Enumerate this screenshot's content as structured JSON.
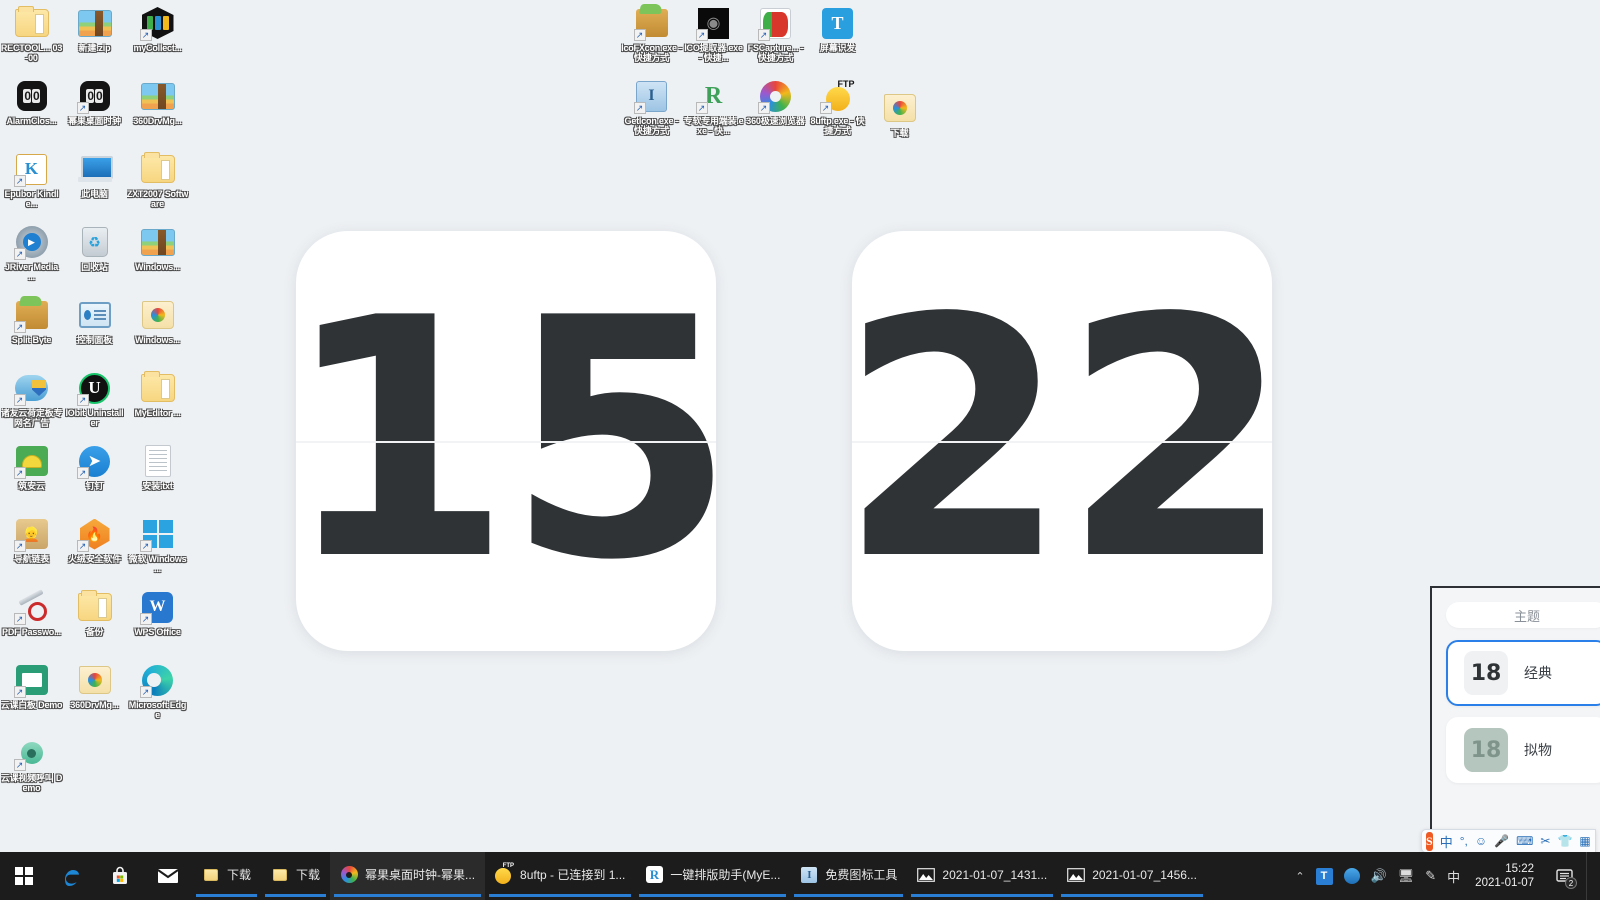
{
  "desktop": {
    "background_color": "#eef1f4",
    "icons_left": [
      {
        "label": "RECTOOL... 03-00",
        "icon": "folder-icon",
        "shortcut": false,
        "art": "folder"
      },
      {
        "label": "新建.zip",
        "icon": "zip-archive-icon",
        "shortcut": false,
        "art": "zip"
      },
      {
        "label": "myCollect...",
        "icon": "mycollect-icon",
        "shortcut": true,
        "art": "hexbook"
      },
      {
        "label": "AlarmClos...",
        "icon": "alarm-clock-icon",
        "shortcut": false,
        "art": "blackbox"
      },
      {
        "label": "幂果桌面时钟",
        "icon": "flip-clock-icon",
        "shortcut": true,
        "art": "blackbox"
      },
      {
        "label": "360DrvMg...",
        "icon": "zip-archive-icon",
        "shortcut": false,
        "art": "zip"
      },
      {
        "label": "Epubor Kindle...",
        "icon": "epubor-icon",
        "shortcut": true,
        "art": "epubor"
      },
      {
        "label": "此电脑",
        "icon": "this-pc-icon",
        "shortcut": false,
        "art": "monitor"
      },
      {
        "label": "ZXT2007 Software",
        "icon": "folder-icon",
        "shortcut": false,
        "art": "folder"
      },
      {
        "label": "JRiver Media ...",
        "icon": "jriver-icon",
        "shortcut": true,
        "art": "disc"
      },
      {
        "label": "回收站",
        "icon": "recycle-bin-icon",
        "shortcut": false,
        "art": "trash"
      },
      {
        "label": "Windows...",
        "icon": "zip-archive-icon",
        "shortcut": false,
        "art": "zip"
      },
      {
        "label": "Split Byte",
        "icon": "split-byte-icon",
        "shortcut": true,
        "art": "box3d"
      },
      {
        "label": "控制面板",
        "icon": "control-panel-icon",
        "shortcut": false,
        "art": "cpanel"
      },
      {
        "label": "Windows...",
        "icon": "folder-icon",
        "shortcut": false,
        "art": "folderimg"
      },
      {
        "label": "诸友云荷定板专网名广告",
        "icon": "cloud-shield-icon",
        "shortcut": true,
        "art": "cloud"
      },
      {
        "label": "IObit Uninstaller",
        "icon": "iobit-uninstaller-icon",
        "shortcut": true,
        "art": "circleU"
      },
      {
        "label": "MyEditor ...",
        "icon": "folder-icon",
        "shortcut": false,
        "art": "folder"
      },
      {
        "label": "筑安云",
        "icon": "helmet-icon",
        "shortcut": true,
        "art": "helmet"
      },
      {
        "label": "钉钉",
        "icon": "dingtalk-icon",
        "shortcut": true,
        "art": "ding"
      },
      {
        "label": "安装.txt",
        "icon": "text-file-icon",
        "shortcut": false,
        "art": "txt"
      },
      {
        "label": "导航链表",
        "icon": "avatar-shield-icon",
        "shortcut": true,
        "art": "avatar"
      },
      {
        "label": "火绒安全软件",
        "icon": "huorong-icon",
        "shortcut": true,
        "art": "flame"
      },
      {
        "label": "微软 Windows ...",
        "icon": "windows-logo-icon",
        "shortcut": true,
        "art": "win"
      },
      {
        "label": "PDF Passwo...",
        "icon": "pdf-password-icon",
        "shortcut": true,
        "art": "pdf"
      },
      {
        "label": "备份",
        "icon": "folder-icon",
        "shortcut": false,
        "art": "folder"
      },
      {
        "label": "WPS Office",
        "icon": "wps-office-icon",
        "shortcut": true,
        "art": "wps"
      },
      {
        "label": "云课白板 Demo",
        "icon": "whiteboard-demo-icon",
        "shortcut": true,
        "art": "board"
      },
      {
        "label": "360DrvMg...",
        "icon": "folder-icon",
        "shortcut": false,
        "art": "folderimg"
      },
      {
        "label": "Microsoft Edge",
        "icon": "edge-icon",
        "shortcut": true,
        "art": "edge"
      },
      {
        "label": "云课视频呼叫 Demo",
        "icon": "video-call-demo-icon",
        "shortcut": true,
        "art": "cam"
      }
    ],
    "icons_mid": [
      {
        "label": "IcoFXcon.exe - 快捷方式",
        "icon": "icofx-icon",
        "shortcut": true,
        "art": "box3d"
      },
      {
        "label": "ICO提取器.exe - 快捷...",
        "icon": "ico-extractor-icon",
        "shortcut": true,
        "art": "darkgrid"
      },
      {
        "label": "FSCapture... - 快捷方式",
        "icon": "fscapture-icon",
        "shortcut": true,
        "art": "fsc"
      },
      {
        "label": "屏幕识发",
        "icon": "screen-text-icon",
        "shortcut": false,
        "art": "bluet"
      },
      {
        "label": "GetIcon.exe - 快捷方式",
        "icon": "geticon-icon",
        "shortcut": true,
        "art": "geticon"
      },
      {
        "label": "专软专用端装.exe - 快...",
        "icon": "ruanjian-icon",
        "shortcut": true,
        "art": "rlogo"
      },
      {
        "label": "360极速浏览器",
        "icon": "360-browser-icon",
        "shortcut": true,
        "art": "360"
      },
      {
        "label": "8uftp.exe - 快捷方式",
        "icon": "8uftp-icon",
        "shortcut": true,
        "art": "ftp"
      }
    ],
    "icons_mid2": [
      {
        "label": "下载",
        "icon": "folder-icon",
        "shortcut": false,
        "art": "folderimg"
      }
    ]
  },
  "clock": {
    "hour": "15",
    "minute": "22",
    "card_color": "#ffffff",
    "digit_color": "#2f3336"
  },
  "theme_panel": {
    "header": "主题",
    "items": [
      {
        "label": "经典",
        "thumb": "18",
        "selected": true
      },
      {
        "label": "拟物",
        "thumb": "18",
        "selected": false
      }
    ],
    "accent_color": "#2a7fe8"
  },
  "ime_bar": {
    "logo": "S",
    "items": [
      "中",
      "°,",
      "☺",
      "🎤",
      "⌨",
      "✂",
      "👕",
      "▦"
    ]
  },
  "taskbar": {
    "background_color": "#1c1c1c",
    "start_label": "start-button",
    "pinned": [
      {
        "label": "Microsoft Edge",
        "icon": "edge-icon"
      },
      {
        "label": "Microsoft Store",
        "icon": "store-icon"
      },
      {
        "label": "Mail",
        "icon": "mail-icon"
      }
    ],
    "tasks": [
      {
        "label": "下载",
        "icon": "folder-icon",
        "active": false
      },
      {
        "label": "下载",
        "icon": "folder-icon",
        "active": false
      },
      {
        "label": "幂果桌面时钟-幂果...",
        "icon": "360-browser-icon",
        "active": true
      },
      {
        "label": "8uftp - 已连接到 1...",
        "icon": "8uftp-icon",
        "active": false
      },
      {
        "label": "一键排版助手(MyE...",
        "icon": "ruanjian-icon",
        "active": false
      },
      {
        "label": "免费图标工具",
        "icon": "geticon-icon",
        "active": false
      },
      {
        "label": "2021-01-07_1431...",
        "icon": "image-icon",
        "active": false
      },
      {
        "label": "2021-01-07_1456...",
        "icon": "image-icon",
        "active": false
      }
    ],
    "tray": {
      "chevron": "⌃",
      "items": [
        "T",
        "tencent-dot",
        "🔊",
        "🖥",
        "✎",
        "中"
      ],
      "time": "15:22",
      "date": "2021-01-07",
      "notification_count": "2"
    }
  }
}
